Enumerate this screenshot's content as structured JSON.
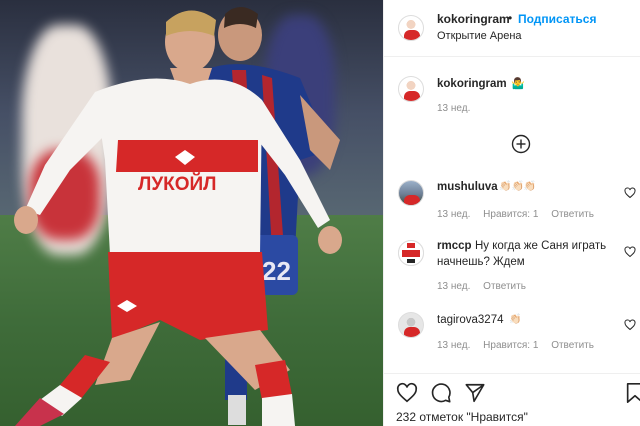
{
  "post": {
    "username": "kokoringram",
    "separator": "•",
    "follow_label": "Подписаться",
    "location": "Открытие Арена",
    "caption_user": "kokoringram",
    "caption_text": "🤷‍♂️",
    "caption_time": "13 нед."
  },
  "comments": [
    {
      "user": "mushuluva",
      "text": "👏🏻👏🏻👏🏻",
      "time": "13 нед.",
      "likes": "Нравится: 1",
      "reply": "Ответить"
    },
    {
      "user": "rmccp",
      "text": "Ну когда же Саня играть начнешь? Ждем",
      "time": "13 нед.",
      "reply": "Ответить"
    },
    {
      "user": "tagirova3274",
      "text": "👏🏻",
      "time": "13 нед.",
      "likes": "Нравится: 1",
      "reply": "Ответить"
    }
  ],
  "footer": {
    "likes_text": "232 отметок \"Нравится\""
  },
  "colors": {
    "accent": "#0095f6",
    "spartak_red": "#d62828",
    "cska_blue": "#1f3a8a"
  },
  "icons": [
    "heart-icon",
    "comment-icon",
    "share-icon",
    "bookmark-icon",
    "plus-circle-icon"
  ]
}
